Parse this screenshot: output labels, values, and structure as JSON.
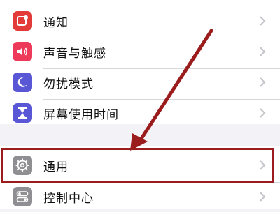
{
  "settings": {
    "items": [
      {
        "label": "通知",
        "icon": "notifications-icon",
        "color": "#e33a3a"
      },
      {
        "label": "声音与触感",
        "icon": "sounds-icon",
        "color": "#ee3a5a"
      },
      {
        "label": "勿扰模式",
        "icon": "moon-icon",
        "color": "#5a57d6"
      },
      {
        "label": "屏幕使用时间",
        "icon": "hourglass-icon",
        "color": "#5a57d6"
      },
      {
        "label": "通用",
        "icon": "gear-icon",
        "color": "#8e8e93"
      },
      {
        "label": "控制中心",
        "icon": "control-center-icon",
        "color": "#8e8e93"
      }
    ]
  },
  "annotation": {
    "highlight_color": "#9b1c1c",
    "highlighted_item": "通用"
  }
}
